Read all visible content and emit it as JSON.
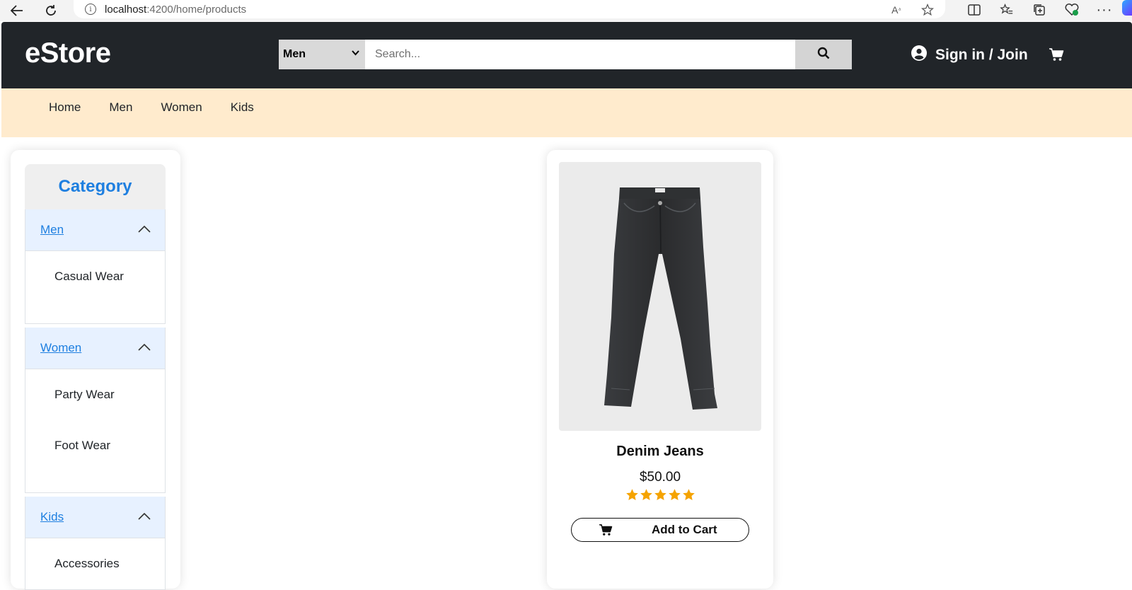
{
  "browser": {
    "url_host": "localhost",
    "url_rest": ":4200/home/products"
  },
  "header": {
    "brand": "eStore",
    "search_category": "Men",
    "search_placeholder": "Search...",
    "signin_label": "Sign in / Join"
  },
  "subnav": {
    "items": [
      "Home",
      "Men",
      "Women",
      "Kids"
    ]
  },
  "sidebar": {
    "title": "Category",
    "groups": [
      {
        "label": "Men",
        "items": [
          "Casual Wear"
        ]
      },
      {
        "label": "Women",
        "items": [
          "Party Wear",
          "Foot Wear"
        ]
      },
      {
        "label": "Kids",
        "items": [
          "Accessories"
        ]
      }
    ]
  },
  "product": {
    "name": "Denim Jeans",
    "price": "$50.00",
    "rating": 5,
    "rating_max": 5,
    "add_label": "Add to Cart"
  },
  "colors": {
    "header_bg": "#212529",
    "subnav_bg": "#ffebcd",
    "accent_blue": "#1e7fe0",
    "star": "#f5a300"
  }
}
